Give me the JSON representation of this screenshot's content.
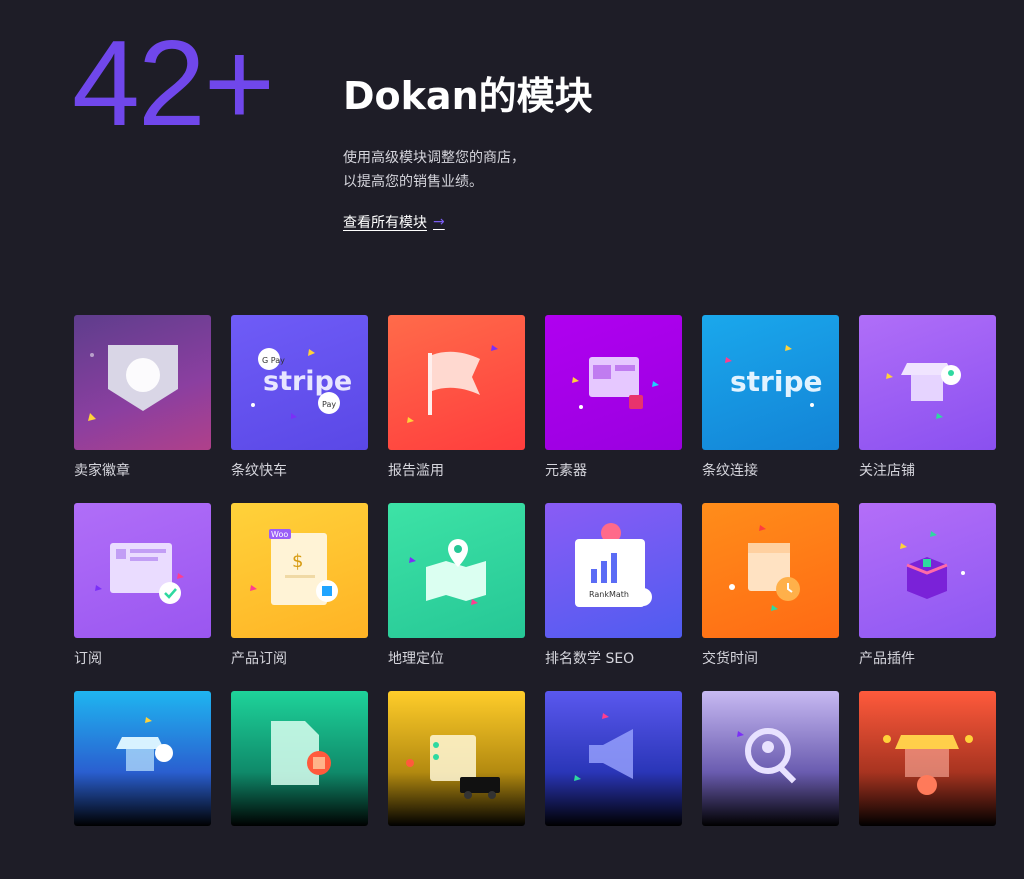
{
  "hero": {
    "count": "42+",
    "title": "Dokan的模块",
    "description_line1": "使用高级模块调整您的商店，",
    "description_line2": "以提高您的销售业绩。",
    "link_label": "查看所有模块",
    "link_arrow": "→"
  },
  "modules": [
    {
      "label": "卖家徽章",
      "icon": "badge-icon",
      "color": "#8b3fa0"
    },
    {
      "label": "条纹快车",
      "icon": "stripe-express-icon",
      "color": "#6d5cf7"
    },
    {
      "label": "报告滥用",
      "icon": "flag-icon",
      "color": "#ff4e3f"
    },
    {
      "label": "元素器",
      "icon": "elementor-icon",
      "color": "#a200ef"
    },
    {
      "label": "条纹连接",
      "icon": "stripe-connect-icon",
      "color": "#1a9fe6"
    },
    {
      "label": "关注店铺",
      "icon": "follow-store-icon",
      "color": "#9a5cf7"
    },
    {
      "label": "订阅",
      "icon": "subscription-icon",
      "color": "#a05cf7"
    },
    {
      "label": "产品订阅",
      "icon": "product-subscription-icon",
      "color": "#ffc22f"
    },
    {
      "label": "地理定位",
      "icon": "geolocation-icon",
      "color": "#2ed9a0"
    },
    {
      "label": "排名数学 SEO",
      "icon": "rankmath-icon",
      "color": "#6c5df5"
    },
    {
      "label": "交货时间",
      "icon": "delivery-time-icon",
      "color": "#ff8416"
    },
    {
      "label": "产品插件",
      "icon": "product-addon-icon",
      "color": "#9b5ff7"
    },
    {
      "label": "",
      "icon": "store-paypal-icon",
      "color": "#1fb5f0"
    },
    {
      "label": "",
      "icon": "document-icon",
      "color": "#1ed39a"
    },
    {
      "label": "",
      "icon": "shipping-truck-icon",
      "color": "#ffcd2a"
    },
    {
      "label": "",
      "icon": "megaphone-icon",
      "color": "#4455e8"
    },
    {
      "label": "",
      "icon": "vendor-search-icon",
      "color": "#c3b4f0"
    },
    {
      "label": "",
      "icon": "storefront-icon",
      "color": "#ff5a3c"
    }
  ],
  "colors": {
    "background": "#1e1d27",
    "accent": "#7047eb"
  }
}
